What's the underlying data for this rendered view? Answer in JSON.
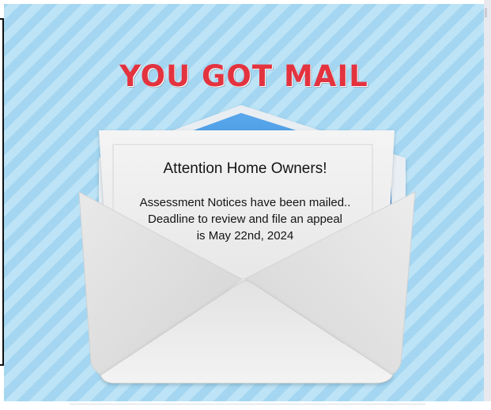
{
  "poster": {
    "headline": "YOU GOT MAIL",
    "letter": {
      "title": "Attention Home Owners!",
      "lines": [
        "Assessment Notices have been mailed..",
        "Deadline to review and file an appeal",
        "is May 22nd, 2024"
      ]
    }
  },
  "colors": {
    "headline": "#e3333f",
    "stripe_light": "#bde3f6",
    "stripe_dark": "#a4d6f1",
    "envelope_lining": "#2f7fd2"
  },
  "icons": {
    "envelope": "open-envelope-icon"
  }
}
